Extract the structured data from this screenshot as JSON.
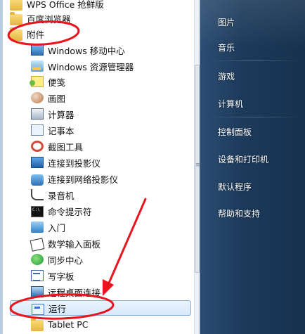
{
  "start_menu": {
    "programs": [
      {
        "label": "WPS Office 抢鲜版",
        "icon": "wps-folder-icon"
      },
      {
        "label": "百度浏览器",
        "icon": "folder-icon"
      },
      {
        "label": "附件",
        "icon": "folder-icon"
      }
    ],
    "accessories": [
      {
        "label": "Windows 移动中心",
        "icon": "mobility-center-icon"
      },
      {
        "label": "Windows 资源管理器",
        "icon": "explorer-icon"
      },
      {
        "label": "便笺",
        "icon": "sticky-notes-icon"
      },
      {
        "label": "画图",
        "icon": "paint-icon"
      },
      {
        "label": "计算器",
        "icon": "calculator-icon"
      },
      {
        "label": "记事本",
        "icon": "notepad-icon"
      },
      {
        "label": "截图工具",
        "icon": "snipping-tool-icon"
      },
      {
        "label": "连接到投影仪",
        "icon": "projector-icon"
      },
      {
        "label": "连接到网络投影仪",
        "icon": "network-projector-icon"
      },
      {
        "label": "录音机",
        "icon": "sound-recorder-icon"
      },
      {
        "label": "命令提示符",
        "icon": "command-prompt-icon"
      },
      {
        "label": "入门",
        "icon": "getting-started-icon"
      },
      {
        "label": "数学输入面板",
        "icon": "math-input-icon"
      },
      {
        "label": "同步中心",
        "icon": "sync-center-icon"
      },
      {
        "label": "写字板",
        "icon": "wordpad-icon"
      },
      {
        "label": "远程桌面连接",
        "icon": "remote-desktop-icon"
      },
      {
        "label": "运行",
        "icon": "run-icon",
        "selected": true
      },
      {
        "label": "Tablet PC",
        "icon": "folder-icon"
      }
    ],
    "right_links": [
      {
        "label": "图片"
      },
      {
        "label": "音乐"
      },
      {
        "label": "游戏"
      },
      {
        "label": "计算机"
      },
      {
        "label": "控制面板"
      },
      {
        "label": "设备和打印机"
      },
      {
        "label": "默认程序"
      },
      {
        "label": "帮助和支持"
      }
    ],
    "grip_glyph": "≡"
  },
  "colors": {
    "selection_border": "#84acdd",
    "annotation_red": "#e8141e",
    "right_pane_bg": "#1c3a5b"
  }
}
